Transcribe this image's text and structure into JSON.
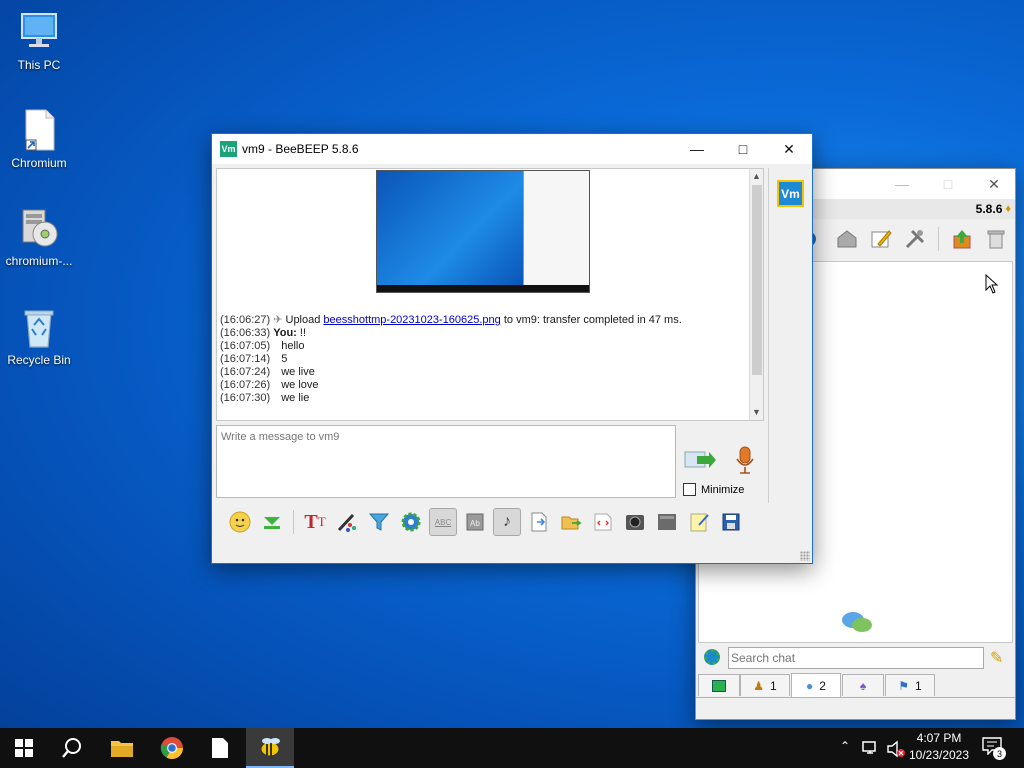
{
  "desktop": {
    "icons": [
      {
        "label": "This PC"
      },
      {
        "label": "Chromium"
      },
      {
        "label": "chromium-..."
      },
      {
        "label": "Recycle Bin"
      }
    ]
  },
  "chat_window": {
    "title": "vm9 - BeeBEEP 5.8.6",
    "app_icon": "Vm",
    "user_badge": "Vm",
    "log": [
      {
        "time": "(16:06:27)",
        "prefix": "Upload",
        "link": "beesshottmp-20231023-160625.png",
        "suffix": "to vm9: transfer completed in 47 ms."
      },
      {
        "time": "(16:06:33)",
        "sender": "You:",
        "text": "!!"
      },
      {
        "time": "(16:07:05)",
        "text": "hello"
      },
      {
        "time": "(16:07:14)",
        "text": "5"
      },
      {
        "time": "(16:07:24)",
        "text": "we live"
      },
      {
        "time": "(16:07:26)",
        "text": "we love"
      },
      {
        "time": "(16:07:30)",
        "text": "we lie"
      }
    ],
    "composer_placeholder": "Write a message to vm9",
    "minimize_label": "Minimize",
    "minimize_checked": false
  },
  "main_window": {
    "version": "5.8.6",
    "search_placeholder": "Search chat",
    "tabs": [
      {
        "icon": "computer-icon",
        "count": ""
      },
      {
        "icon": "users-icon",
        "count": "1"
      },
      {
        "icon": "chat-icon",
        "count": "2"
      },
      {
        "icon": "groups-icon",
        "count": ""
      },
      {
        "icon": "share-icon",
        "count": "1"
      }
    ]
  },
  "taskbar": {
    "time": "4:07 PM",
    "date": "10/23/2023",
    "notification_count": "3"
  },
  "colors": {
    "accent_teal": "#1aa37a",
    "badge_blue": "#1e8ad6",
    "badge_border": "#f5c400",
    "link": "#0000cc"
  }
}
